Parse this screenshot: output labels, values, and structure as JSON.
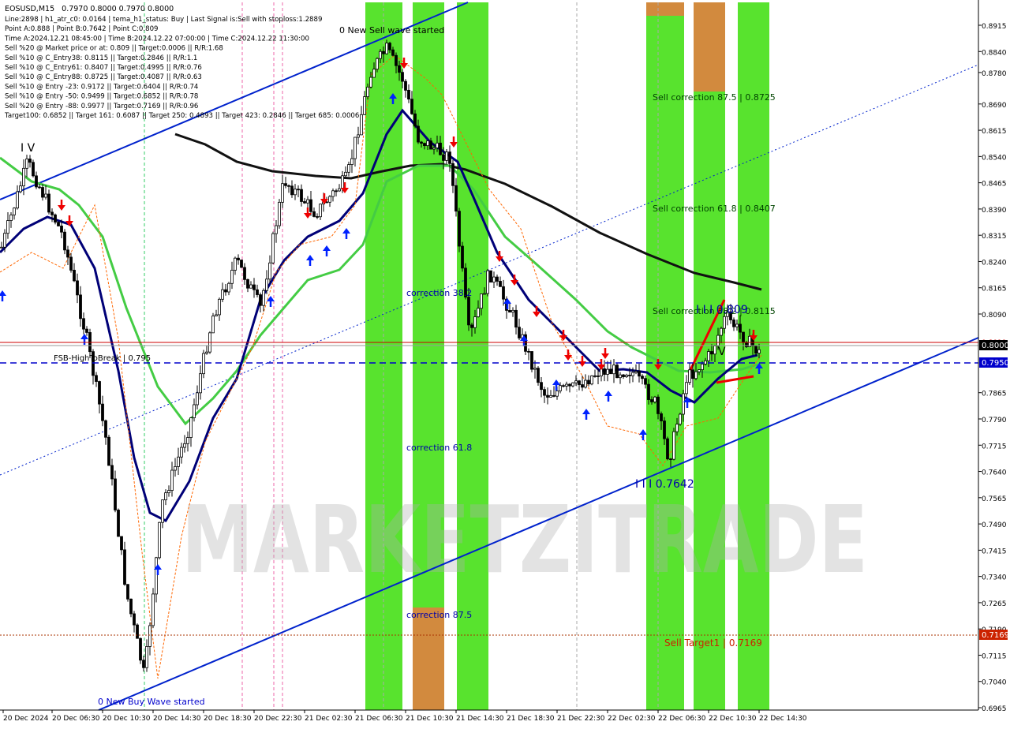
{
  "chart_data": {
    "type": "candlestick",
    "symbol": "EOSUSD,M15",
    "ohlc_header": "0.7970 0.8000 0.7970 0.8000",
    "ylim": [
      0.6965,
      0.9195
    ],
    "y_ticks": [
      "0.8915",
      "0.8840",
      "0.8780",
      "0.8690",
      "0.8615",
      "0.8540",
      "0.8465",
      "0.8390",
      "0.8315",
      "0.8240",
      "0.8165",
      "0.8090",
      "0.7865",
      "0.7790",
      "0.7715",
      "0.7640",
      "0.7565",
      "0.7490",
      "0.7415",
      "0.7340",
      "0.7265",
      "0.7190",
      "0.7115",
      "0.7040",
      "0.6965"
    ],
    "x_ticks": [
      "20 Dec 2024",
      "20 Dec 06:30",
      "20 Dec 10:30",
      "20 Dec 14:30",
      "20 Dec 18:30",
      "20 Dec 22:30",
      "21 Dec 02:30",
      "21 Dec 06:30",
      "21 Dec 10:30",
      "21 Dec 14:30",
      "21 Dec 18:30",
      "21 Dec 22:30",
      "22 Dec 02:30",
      "22 Dec 06:30",
      "22 Dec 10:30",
      "22 Dec 14:30"
    ],
    "info_lines": [
      "Line:2898 | h1_atr_c0: 0.0164 | tema_h1_status: Buy | Last Signal is:Sell with stoploss:1.2889",
      "Point A:0.888 | Point B:0.7642 | Point C:0.809",
      "Time A:2024.12.21 08:45:00 | Time B:2024.12.22 07:00:00 | Time C:2024.12.22 11:30:00",
      "Sell %20 @ Market price or at: 0.809 || Target:0.0006 || R/R:1.68",
      "Sell %10 @ C_Entry38: 0.8115 || Target:0.2846 || R/R:1.1",
      "Sell %10 @ C_Entry61: 0.8407 || Target:0.4995 || R/R:0.76",
      "Sell %10 @ C_Entry88: 0.8725 || Target:0.4087 || R/R:0.63",
      "Sell %10 @ Entry -23: 0.9172 || Target:0.6404 || R/R:0.74",
      "Sell %10 @ Entry -50: 0.9499 || Target:0.6852 || R/R:0.78",
      "Sell %20 @ Entry -88: 0.9977 || Target:0.7169 || R/R:0.96",
      "Target100: 0.6852 || Target 161: 0.6087 || Target 250: 0.4893 || Target 423: 0.2846 || Target 685: 0.0006"
    ],
    "annotations": {
      "sell_wave": "0 New Sell wave started",
      "buy_wave": "0 New Buy Wave started",
      "fsb": "FSB-HighToBreak | 0.795",
      "corr382": "correction 38.2",
      "corr618": "correction 61.8",
      "corr875": "correction 87.5",
      "sell_corr875": "Sell correction 87.5 | 0.8725",
      "sell_corr618": "Sell correction 61.8 | 0.8407",
      "sell_corr382": "Sell correction 38.2 | 0.8115",
      "sell_target": "Sell Target1 | 0.7169",
      "point_b": "I I I 0.7642",
      "point_c": "I I I 0.809",
      "wave_iv": "I V",
      "wave_v": "V"
    },
    "price_levels": {
      "current": "0.8000",
      "red_line_label": "0.8019",
      "fsb_level": "0.7950",
      "target_level": "0.7169"
    },
    "watermark": "MARKETZITRADE",
    "colors": {
      "green_zone": "#33dd00",
      "orange_zone": "#e08040",
      "blue_line": "#0022cc",
      "ma_black": "#111111",
      "ma_green": "#44cc44",
      "ma_navy": "#000077",
      "red_level": "#cc0000",
      "fsb_blue": "#0000cc"
    }
  }
}
